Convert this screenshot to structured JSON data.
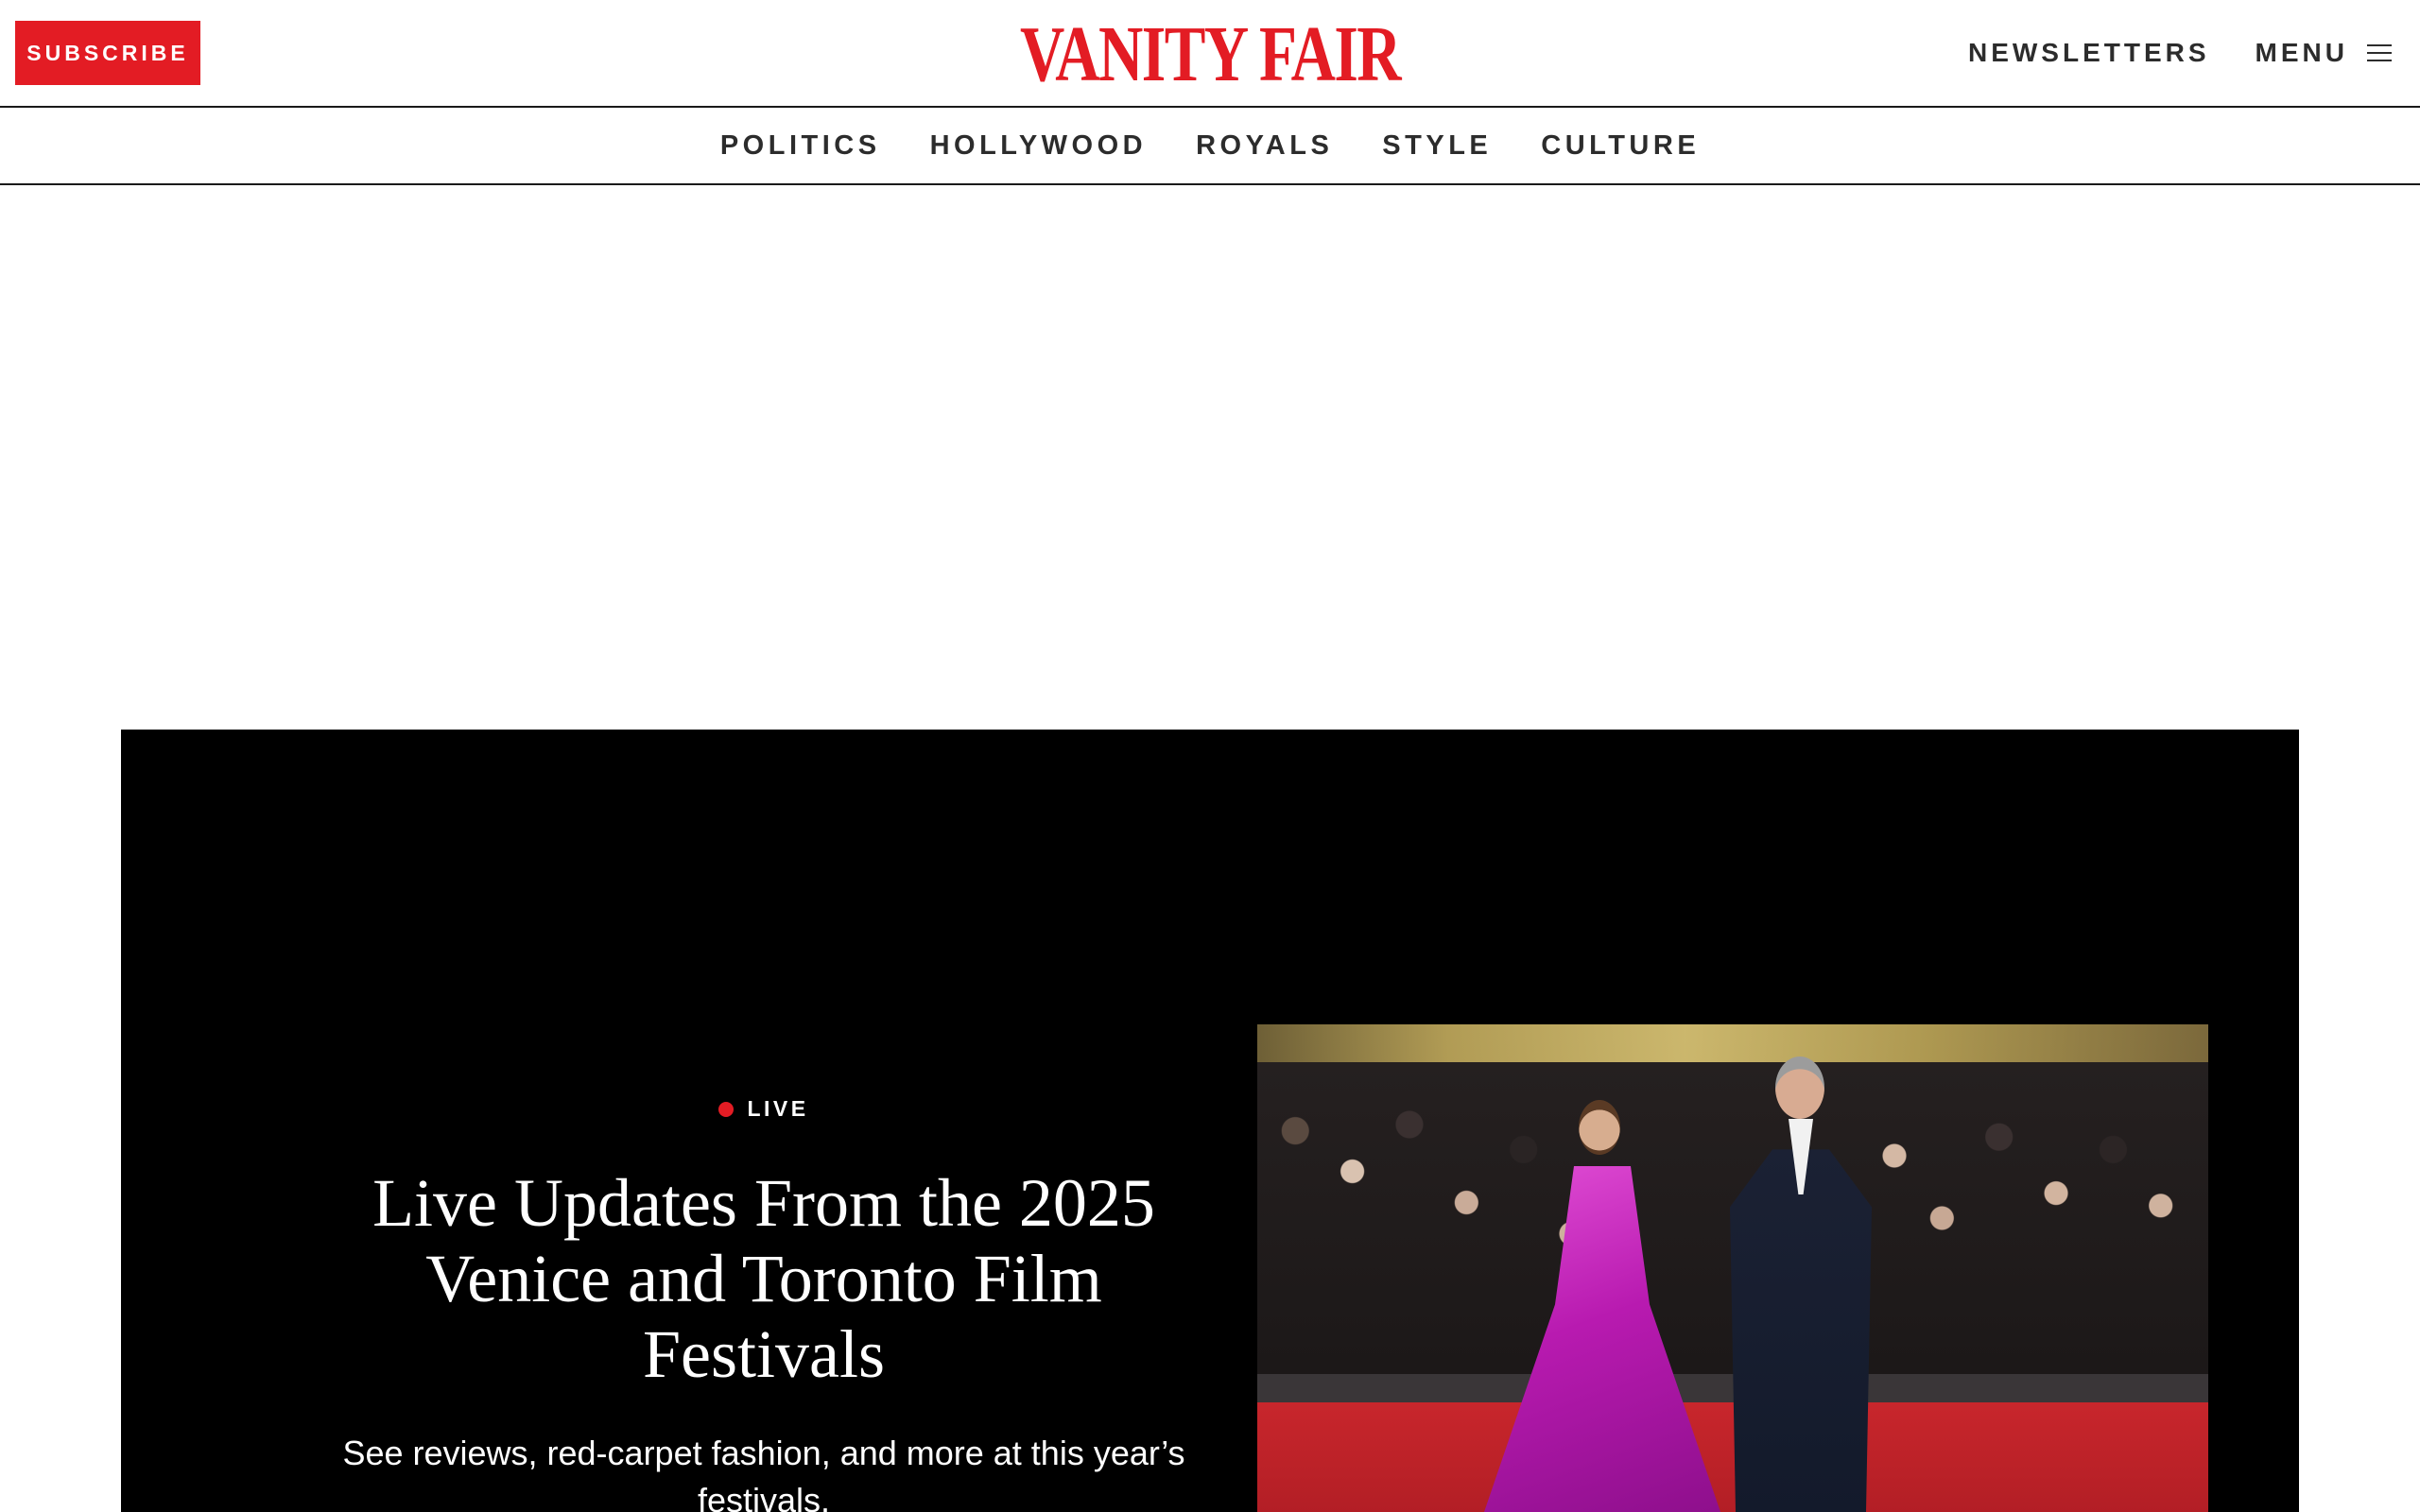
{
  "header": {
    "subscribe_label": "SUBSCRIBE",
    "logo_text": "VANITY FAIR",
    "newsletters_label": "NEWSLETTERS",
    "menu_label": "MENU"
  },
  "nav": {
    "items": [
      {
        "label": "POLITICS"
      },
      {
        "label": "HOLLYWOOD"
      },
      {
        "label": "ROYALS"
      },
      {
        "label": "STYLE"
      },
      {
        "label": "CULTURE"
      }
    ]
  },
  "hero": {
    "badge": "LIVE",
    "title": "Live Updates From the 2025 Venice and Toronto Film Festivals",
    "dek": "See reviews, red-carpet fashion, and more at this year’s festivals."
  },
  "colors": {
    "brand_red": "#e31c24",
    "text_dark": "#2c2c2c",
    "hero_bg": "#000000"
  },
  "icons": {
    "menu": "hamburger-icon",
    "live": "live-dot-icon"
  }
}
